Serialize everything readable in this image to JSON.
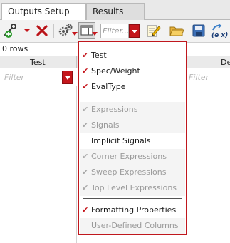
{
  "tabs": [
    {
      "label": "Outputs Setup",
      "active": true
    },
    {
      "label": "Results",
      "active": false
    }
  ],
  "toolbar": {
    "filter_placeholder": "Filter...",
    "expr_label": "(e x)"
  },
  "table": {
    "row_count": "0 rows",
    "columns": [
      {
        "label": "Test"
      },
      {
        "label": "De"
      }
    ],
    "filter_placeholder": "Filter"
  },
  "menu": {
    "items": [
      {
        "label": "Test",
        "checked": true,
        "enabled": true
      },
      {
        "label": "Spec/Weight",
        "checked": true,
        "enabled": true
      },
      {
        "label": "EvalType",
        "checked": true,
        "enabled": true
      },
      {
        "label": "Expressions",
        "checked": true,
        "enabled": false
      },
      {
        "label": "Signals",
        "checked": true,
        "enabled": false
      },
      {
        "label": "Implicit Signals",
        "checked": false,
        "enabled": true
      },
      {
        "label": "Corner Expressions",
        "checked": true,
        "enabled": false
      },
      {
        "label": "Sweep Expressions",
        "checked": true,
        "enabled": false
      },
      {
        "label": "Top Level Expressions",
        "checked": true,
        "enabled": false
      },
      {
        "label": "Formatting Properties",
        "checked": true,
        "enabled": true
      },
      {
        "label": "User-Defined Columns",
        "checked": false,
        "enabled": false
      }
    ]
  },
  "colors": {
    "accent_red": "#c4161c",
    "checkmark_gray": "#a8a8a8"
  }
}
